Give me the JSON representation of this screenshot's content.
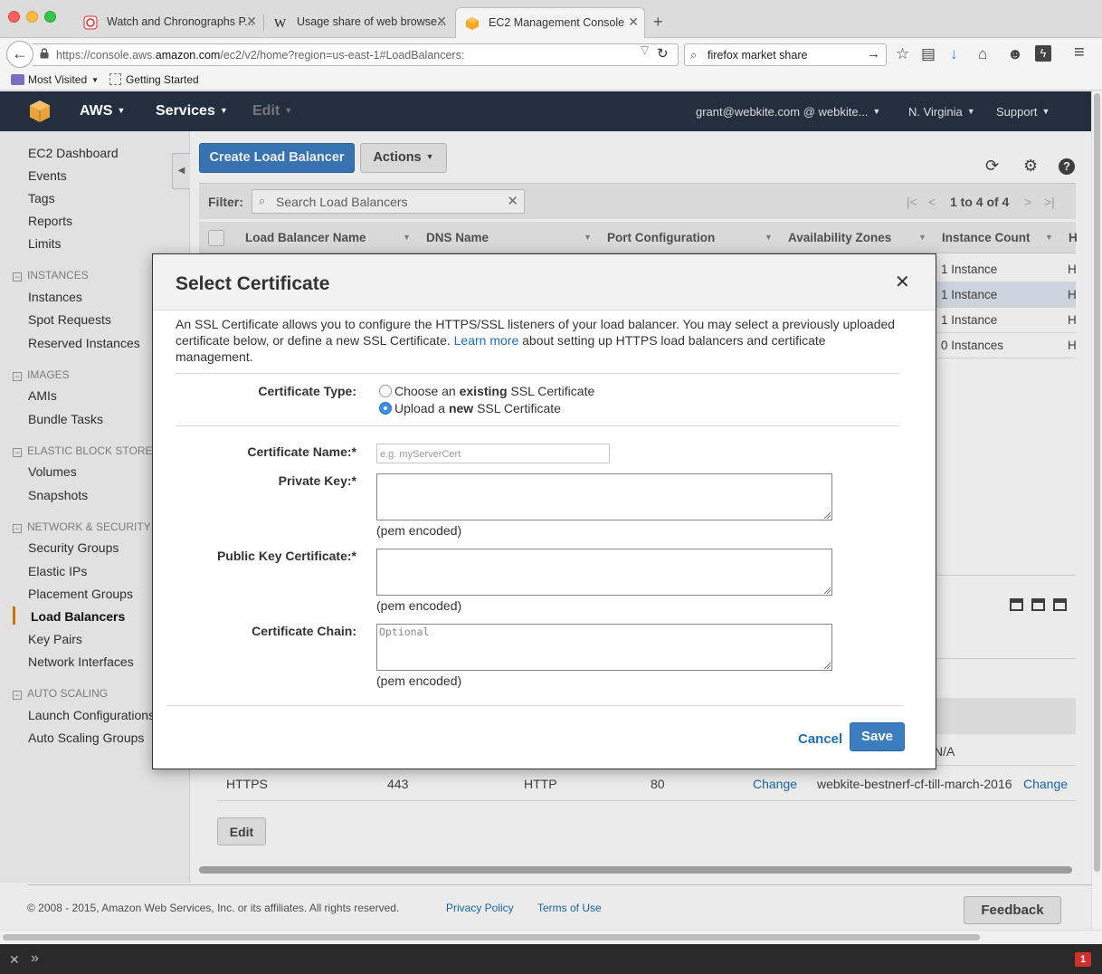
{
  "browser": {
    "tabs": [
      {
        "title": "Watch and Chronographs P..."
      },
      {
        "title": "Usage share of web browse..."
      },
      {
        "title": "EC2 Management Console"
      }
    ],
    "url_prefix": "https://console.aws.",
    "url_domain": "amazon.com",
    "url_suffix": "/ec2/v2/home?region=us-east-1#LoadBalancers:",
    "search_value": "firefox market share",
    "bookmarks": [
      "Most Visited",
      "Getting Started"
    ],
    "notification_count": "1"
  },
  "aws_header": {
    "brand": "AWS",
    "services": "Services",
    "edit": "Edit",
    "account": "grant@webkite.com @ webkite...",
    "region": "N. Virginia",
    "support": "Support"
  },
  "sidebar": {
    "top_links": [
      "EC2 Dashboard",
      "Events",
      "Tags",
      "Reports",
      "Limits"
    ],
    "sections": [
      {
        "title": "INSTANCES",
        "items": [
          "Instances",
          "Spot Requests",
          "Reserved Instances"
        ]
      },
      {
        "title": "IMAGES",
        "items": [
          "AMIs",
          "Bundle Tasks"
        ]
      },
      {
        "title": "ELASTIC BLOCK STORE",
        "items": [
          "Volumes",
          "Snapshots"
        ]
      },
      {
        "title": "NETWORK & SECURITY",
        "items": [
          "Security Groups",
          "Elastic IPs",
          "Placement Groups",
          "Load Balancers",
          "Key Pairs",
          "Network Interfaces"
        ]
      },
      {
        "title": "AUTO SCALING",
        "items": [
          "Launch Configurations",
          "Auto Scaling Groups"
        ]
      }
    ],
    "active_item": "Load Balancers"
  },
  "toolbar": {
    "create_label": "Create Load Balancer",
    "actions_label": "Actions",
    "filter_label": "Filter:",
    "filter_placeholder": "Search Load Balancers",
    "pagination": "1 to 4 of 4"
  },
  "grid": {
    "columns": [
      "Load Balancer Name",
      "DNS Name",
      "Port Configuration",
      "Availability Zones",
      "Instance Count",
      "H"
    ],
    "rows": [
      {
        "instances": "1 Instance",
        "h": "H"
      },
      {
        "instances": "1 Instance",
        "h": "H"
      },
      {
        "instances": "1 Instance",
        "h": "H"
      },
      {
        "instances": "0 Instances",
        "h": "H"
      }
    ]
  },
  "listeners": {
    "partial_value": "N/A",
    "row": {
      "protocol": "HTTPS",
      "port": "443",
      "instance_protocol": "HTTP",
      "instance_port": "80",
      "change1": "Change",
      "certificate": "webkite-bestnerf-cf-till-march-2016",
      "change2": "Change"
    },
    "edit_label": "Edit"
  },
  "footer": {
    "copyright": "© 2008 - 2015, Amazon Web Services, Inc. or its affiliates. All rights reserved.",
    "privacy": "Privacy Policy",
    "terms": "Terms of Use",
    "feedback": "Feedback"
  },
  "modal": {
    "title": "Select Certificate",
    "intro_before": "An SSL Certificate allows you to configure the HTTPS/SSL listeners of your load balancer. You may select a previously uploaded certificate below, or define a new SSL Certificate.",
    "intro_link": "Learn more",
    "intro_after": "about setting up HTTPS load balancers and certificate management.",
    "cert_type_label": "Certificate Type:",
    "option_existing": {
      "before": "Choose an",
      "bold": "existing",
      "after": "SSL Certificate",
      "selected": false
    },
    "option_new": {
      "before": "Upload a",
      "bold": "new",
      "after": "SSL Certificate",
      "selected": true
    },
    "cert_name_label": "Certificate Name:*",
    "cert_name_placeholder": "e.g. myServerCert",
    "private_key_label": "Private Key:*",
    "public_cert_label": "Public Key Certificate:*",
    "chain_label": "Certificate Chain:",
    "chain_placeholder": "Optional",
    "pem_hint": "(pem encoded)",
    "cancel_label": "Cancel",
    "save_label": "Save"
  },
  "colors": {
    "aws_bar": "#232f3e",
    "primary_button": "#3b7dbf",
    "link": "#1d6eb5",
    "active_accent": "#e47911"
  }
}
